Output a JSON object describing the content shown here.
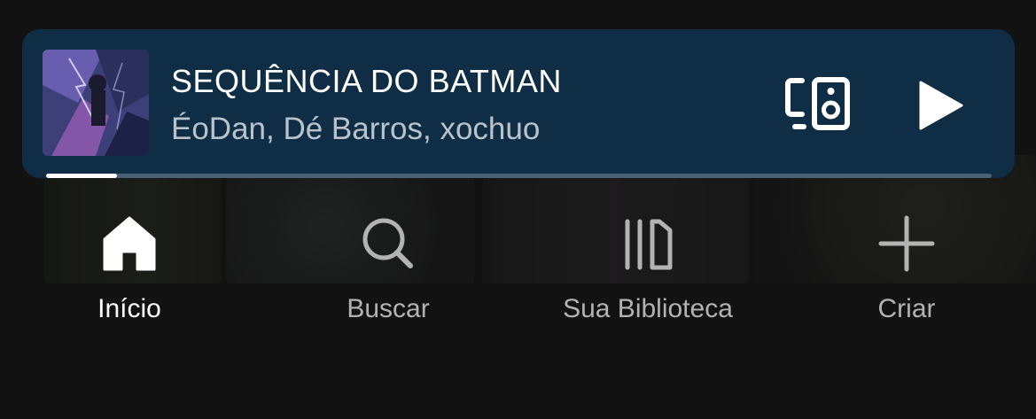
{
  "player": {
    "title": "SEQUÊNCIA DO BATMAN",
    "artists": "ÉoDan, Dé Barros, xochuo",
    "progress_percent": 7.5,
    "device_icon": "connect-device-icon",
    "play_icon": "play-icon",
    "bar_color": "#0f2d45"
  },
  "nav": {
    "items": [
      {
        "label": "Início",
        "icon": "home-icon",
        "active": true
      },
      {
        "label": "Buscar",
        "icon": "search-icon",
        "active": false
      },
      {
        "label": "Sua Biblioteca",
        "icon": "library-icon",
        "active": false
      },
      {
        "label": "Criar",
        "icon": "plus-icon",
        "active": false
      }
    ]
  },
  "colors": {
    "background": "#121212",
    "active_label": "#ffffff",
    "inactive_label": "#b3b3b3"
  }
}
